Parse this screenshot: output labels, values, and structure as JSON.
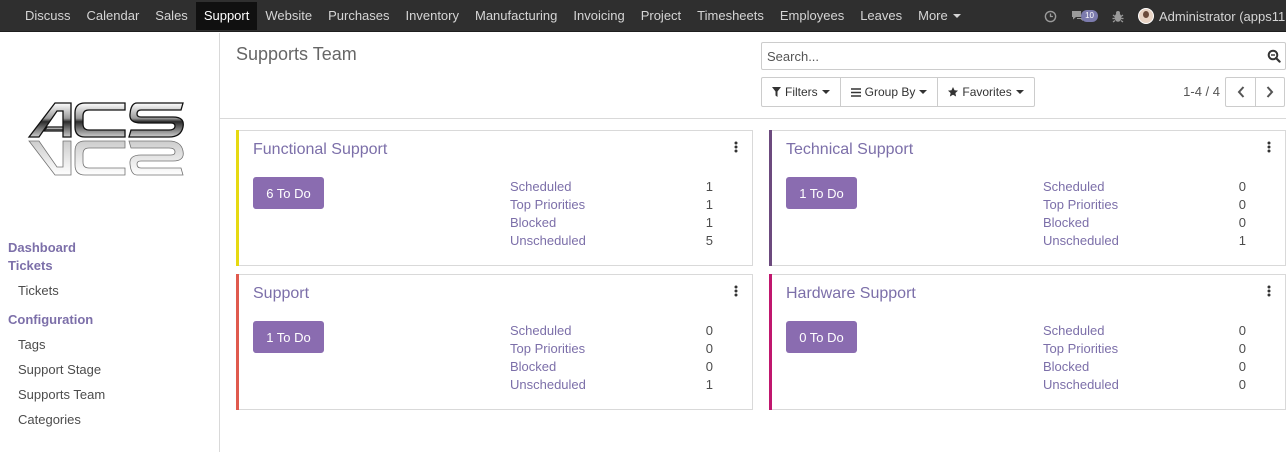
{
  "topbar": {
    "menu": [
      {
        "label": "Discuss"
      },
      {
        "label": "Calendar"
      },
      {
        "label": "Sales"
      },
      {
        "label": "Support",
        "active": true
      },
      {
        "label": "Website"
      },
      {
        "label": "Purchases"
      },
      {
        "label": "Inventory"
      },
      {
        "label": "Manufacturing"
      },
      {
        "label": "Invoicing"
      },
      {
        "label": "Project"
      },
      {
        "label": "Timesheets"
      },
      {
        "label": "Employees"
      },
      {
        "label": "Leaves"
      },
      {
        "label": "More"
      }
    ],
    "message_count": "10",
    "user_name": "Administrator (apps11"
  },
  "sidebar": {
    "logo_text": "ACS",
    "sections": [
      {
        "label": "Dashboard",
        "items": []
      },
      {
        "label": "Tickets",
        "items": [
          "Tickets"
        ]
      },
      {
        "label": "Configuration",
        "items": [
          "Tags",
          "Support Stage",
          "Supports Team",
          "Categories"
        ]
      }
    ]
  },
  "control_panel": {
    "title": "Supports Team",
    "search_placeholder": "Search...",
    "filters_label": "Filters",
    "group_by_label": "Group By",
    "favorites_label": "Favorites",
    "pager_text": "1-4 / 4"
  },
  "teams": [
    {
      "name": "Functional Support",
      "todo": "6 To Do",
      "color": "#e6d911",
      "stats": [
        [
          "Scheduled",
          "1"
        ],
        [
          "Top Priorities",
          "1"
        ],
        [
          "Blocked",
          "1"
        ],
        [
          "Unscheduled",
          "5"
        ]
      ]
    },
    {
      "name": "Technical Support",
      "todo": "1 To Do",
      "color": "#6c4a7e",
      "stats": [
        [
          "Scheduled",
          "0"
        ],
        [
          "Top Priorities",
          "0"
        ],
        [
          "Blocked",
          "0"
        ],
        [
          "Unscheduled",
          "1"
        ]
      ]
    },
    {
      "name": "Support",
      "todo": "1 To Do",
      "color": "#e05a4e",
      "stats": [
        [
          "Scheduled",
          "0"
        ],
        [
          "Top Priorities",
          "0"
        ],
        [
          "Blocked",
          "0"
        ],
        [
          "Unscheduled",
          "1"
        ]
      ]
    },
    {
      "name": "Hardware Support",
      "todo": "0 To Do",
      "color": "#c0176e",
      "stats": [
        [
          "Scheduled",
          "0"
        ],
        [
          "Top Priorities",
          "0"
        ],
        [
          "Blocked",
          "0"
        ],
        [
          "Unscheduled",
          "0"
        ]
      ]
    }
  ],
  "colors": {
    "accent": "#7c6fa9",
    "button": "#8a6cb0",
    "topbar": "#2f2f2f"
  }
}
